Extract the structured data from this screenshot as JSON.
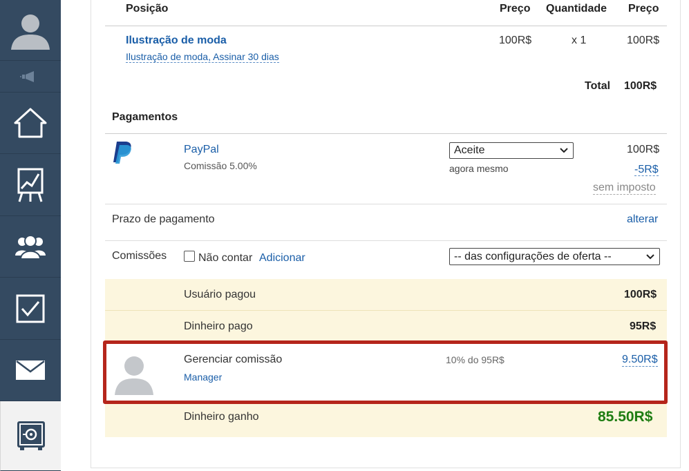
{
  "sidebar": {
    "items": [
      {
        "icon": "user-avatar-icon"
      },
      {
        "icon": "megaphone-icon"
      },
      {
        "icon": "home-icon"
      },
      {
        "icon": "chart-board-icon"
      },
      {
        "icon": "users-group-icon"
      },
      {
        "icon": "checkbox-icon"
      },
      {
        "icon": "mail-icon"
      },
      {
        "icon": "safe-icon",
        "active": true
      }
    ]
  },
  "order": {
    "columns": {
      "position": "Posição",
      "price": "Preço",
      "quantity": "Quantidade",
      "price_total": "Preço"
    },
    "item": {
      "name": "Ilustração de moda",
      "subtitle": "Ilustração de moda, Assinar 30 dias",
      "price": "100R$",
      "quantity": "x 1",
      "total": "100R$"
    },
    "total_label": "Total",
    "total_value": "100R$"
  },
  "payments": {
    "title": "Pagamentos",
    "method": {
      "name": "PayPal",
      "commission": "Comissão 5.00%",
      "status": "Aceite",
      "status_time": "agora mesmo",
      "amount": "100R$",
      "fee": "-5R$",
      "tax_note": "sem imposto"
    }
  },
  "payment_term": {
    "label": "Prazo de pagamento",
    "action": "alterar"
  },
  "commissions": {
    "label": "Comissões",
    "checkbox_label": "Não contar",
    "add_label": "Adicionar",
    "select_value": "-- das configurações de oferta --"
  },
  "summary": {
    "user_paid_label": "Usuário pagou",
    "user_paid_value": "100R$",
    "money_paid_label": "Dinheiro pago",
    "money_paid_value": "95R$",
    "commission_title": "Gerenciar comissão",
    "commission_role": "Manager",
    "commission_calc": "10% do 95R$",
    "commission_value": "9.50R$",
    "earned_label": "Dinheiro ganho",
    "earned_value": "85.50R$"
  },
  "colors": {
    "sidebar": "#344a61",
    "link": "#1a5ea8",
    "highlight_border": "#b5251b",
    "band": "#fcf6de",
    "earned": "#1e7d12"
  }
}
